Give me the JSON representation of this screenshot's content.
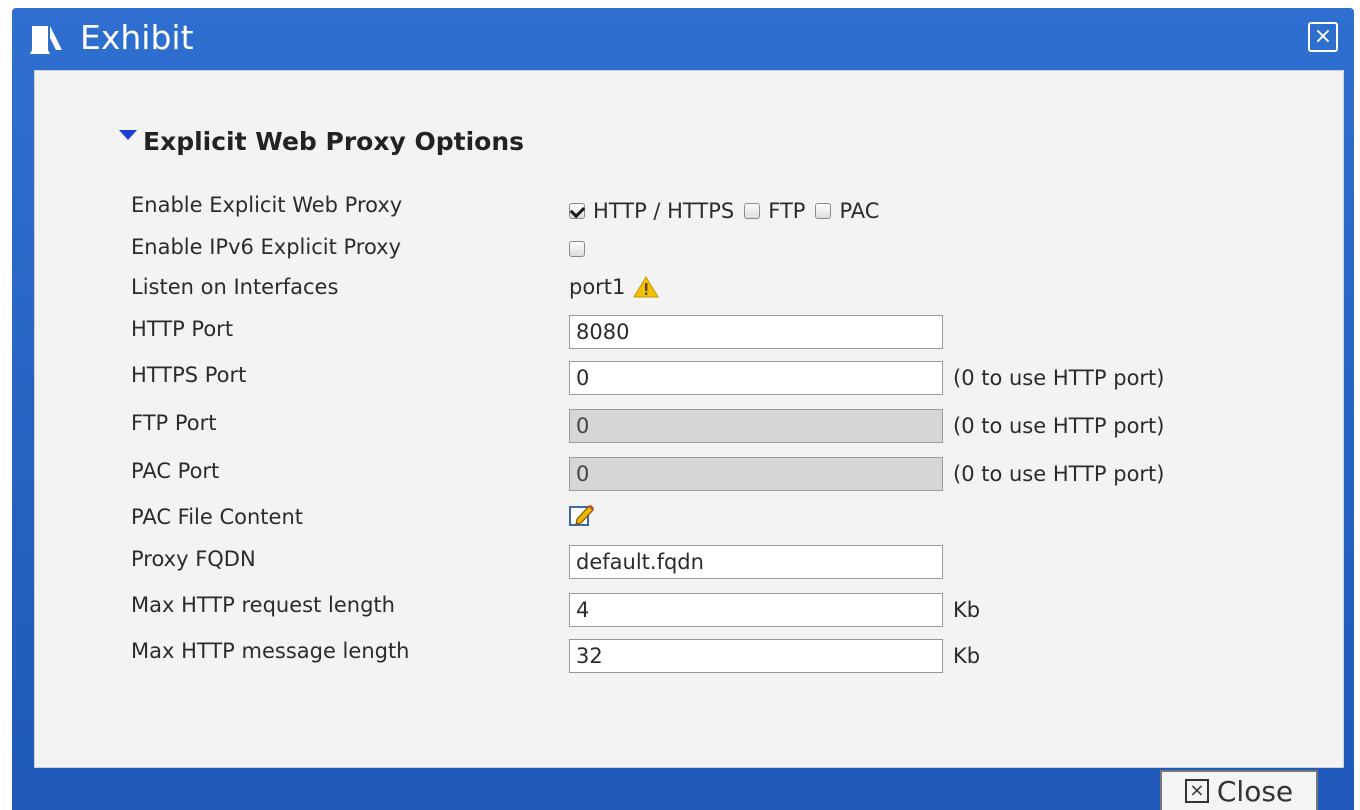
{
  "window": {
    "title": "Exhibit",
    "close_glyph": "×",
    "title_icon": "exhibit-icon"
  },
  "section": {
    "title": "Explicit Web Proxy Options",
    "expanded": true
  },
  "fields": {
    "enable_explicit": {
      "label": "Enable Explicit Web Proxy",
      "options": [
        {
          "label": "HTTP / HTTPS",
          "checked": true
        },
        {
          "label": "FTP",
          "checked": false
        },
        {
          "label": "PAC",
          "checked": false
        }
      ]
    },
    "enable_ipv6": {
      "label": "Enable IPv6 Explicit Proxy",
      "checked": false
    },
    "listen_interfaces": {
      "label": "Listen on Interfaces",
      "value": "port1",
      "icon": "warning-icon"
    },
    "http_port": {
      "label": "HTTP Port",
      "value": "8080"
    },
    "https_port": {
      "label": "HTTPS Port",
      "value": "0",
      "hint": "(0 to use HTTP port)"
    },
    "ftp_port": {
      "label": "FTP Port",
      "value": "0",
      "hint": "(0 to use HTTP port)",
      "disabled": true
    },
    "pac_port": {
      "label": "PAC Port",
      "value": "0",
      "hint": "(0 to use HTTP port)",
      "disabled": true
    },
    "pac_file": {
      "label": "PAC File Content",
      "icon": "edit-icon"
    },
    "proxy_fqdn": {
      "label": "Proxy FQDN",
      "value": "default.fqdn"
    },
    "max_request": {
      "label": "Max HTTP request length",
      "value": "4",
      "unit": "Kb"
    },
    "max_message": {
      "label": "Max HTTP message length",
      "value": "32",
      "unit": "Kb"
    }
  },
  "footer": {
    "close_label": "Close",
    "close_glyph": "×"
  },
  "colors": {
    "title_bar": "#2f6fd0",
    "panel_bg": "#f3f3f3",
    "disabled_input": "#d6d6d6",
    "accent_arrow": "#1d3fd6",
    "warning": "#f2c200"
  }
}
